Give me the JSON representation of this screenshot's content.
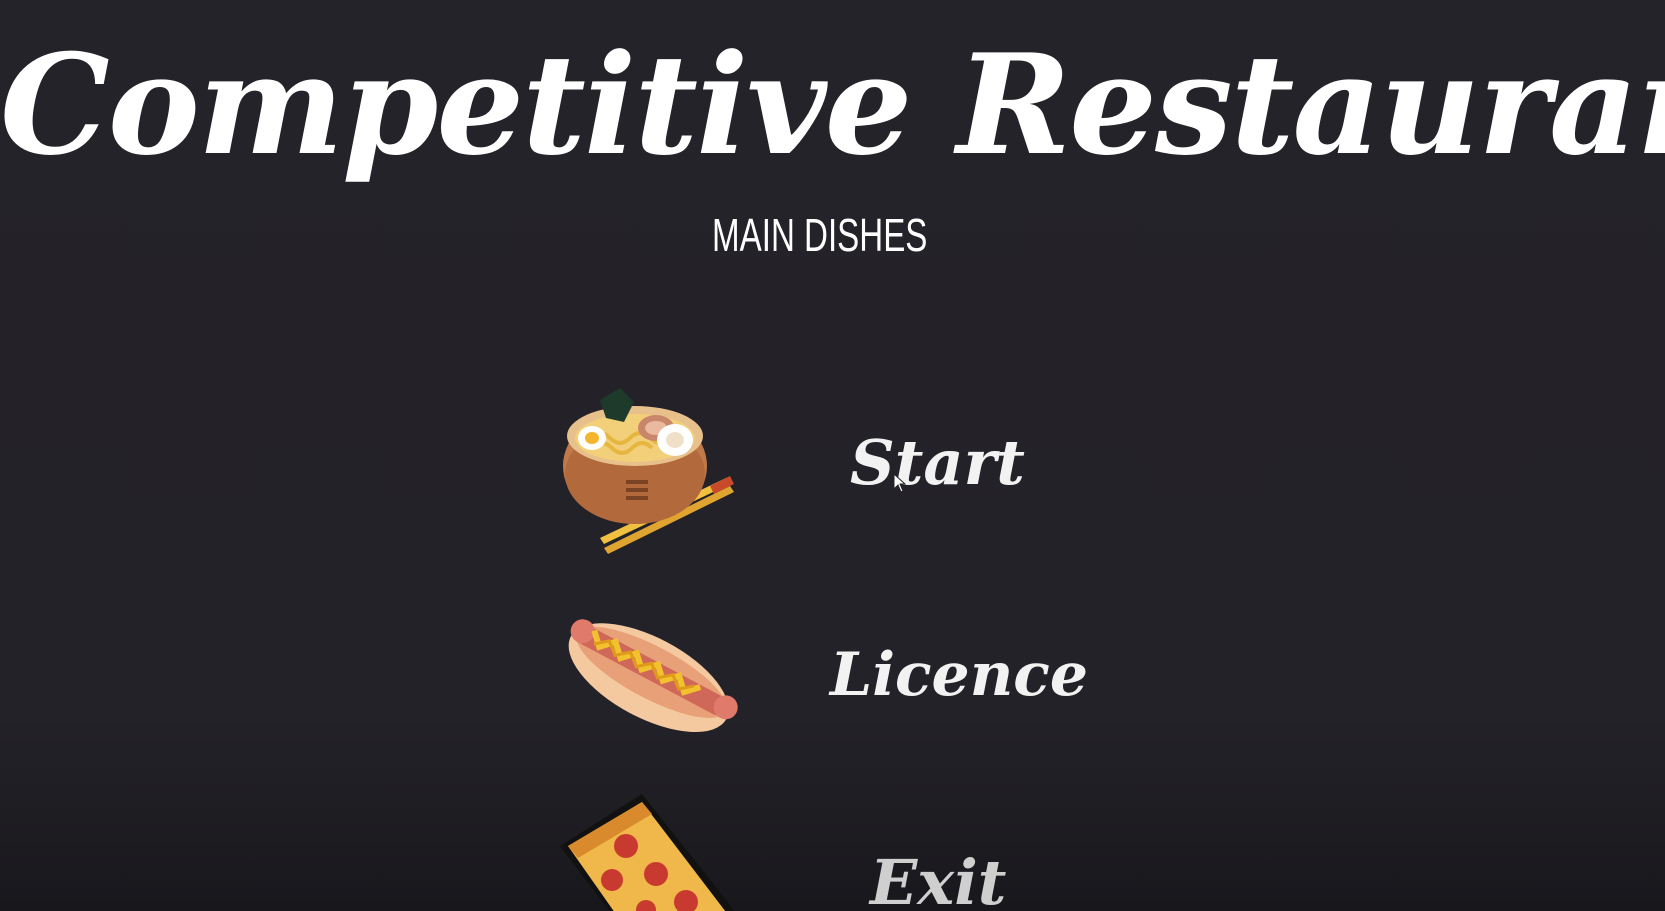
{
  "title": "Competitive Restaurants",
  "subtitle": "MAIN DISHES",
  "menu": {
    "items": [
      {
        "label": "Start",
        "icon": "ramen-bowl-icon"
      },
      {
        "label": "Licence",
        "icon": "hotdog-icon"
      },
      {
        "label": "Exit",
        "icon": "pizza-slice-icon"
      }
    ]
  },
  "colors": {
    "background": "#232228",
    "text": "#ffffff"
  }
}
